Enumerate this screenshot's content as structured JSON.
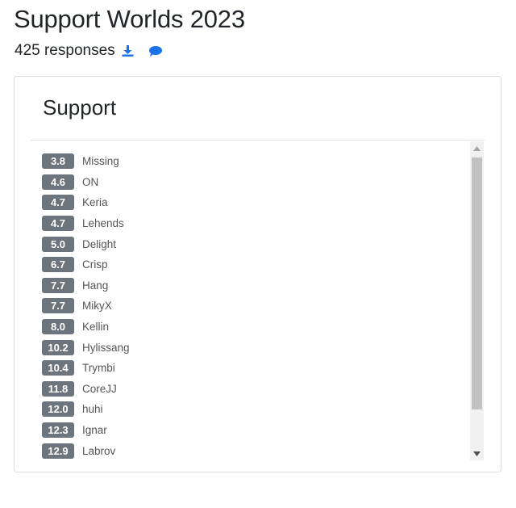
{
  "header": {
    "title": "Support Worlds 2023",
    "responses": "425 responses",
    "download_icon": "download-icon",
    "comment_icon": "comment-icon",
    "accent_color": "#1a73e8"
  },
  "card": {
    "title": "Support",
    "badge_color": "#6c757d",
    "items": [
      {
        "score": "3.8",
        "name": "Missing"
      },
      {
        "score": "4.6",
        "name": "ON"
      },
      {
        "score": "4.7",
        "name": "Keria"
      },
      {
        "score": "4.7",
        "name": "Lehends"
      },
      {
        "score": "5.0",
        "name": "Delight"
      },
      {
        "score": "6.7",
        "name": "Crisp"
      },
      {
        "score": "7.7",
        "name": "Hang"
      },
      {
        "score": "7.7",
        "name": "MikyX"
      },
      {
        "score": "8.0",
        "name": "Kellin"
      },
      {
        "score": "10.2",
        "name": "Hylissang"
      },
      {
        "score": "10.4",
        "name": "Trymbi"
      },
      {
        "score": "11.8",
        "name": "CoreJJ"
      },
      {
        "score": "12.0",
        "name": "huhi"
      },
      {
        "score": "12.3",
        "name": "Ignar"
      },
      {
        "score": "12.9",
        "name": "Labrov"
      }
    ]
  }
}
